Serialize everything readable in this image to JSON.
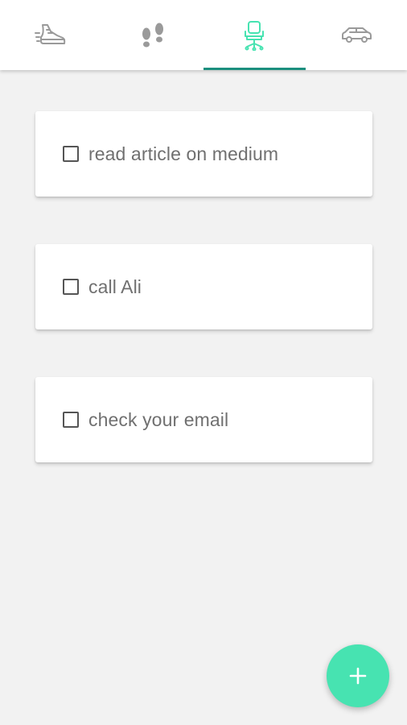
{
  "tabs": [
    {
      "icon": "running-shoe-icon",
      "selected": false
    },
    {
      "icon": "footprints-icon",
      "selected": false
    },
    {
      "icon": "office-chair-icon",
      "selected": true
    },
    {
      "icon": "car-icon",
      "selected": false
    }
  ],
  "todos": [
    {
      "text": "read article on medium",
      "checked": false
    },
    {
      "text": "call Ali",
      "checked": false
    },
    {
      "text": "check your email",
      "checked": false
    }
  ],
  "fab": {
    "icon": "plus-icon"
  },
  "colors": {
    "accent": "#47e3b1",
    "indicator": "#1b8f7e",
    "icon_inactive": "#9a9a9a",
    "background": "#f2f2f2",
    "text": "#707070"
  }
}
